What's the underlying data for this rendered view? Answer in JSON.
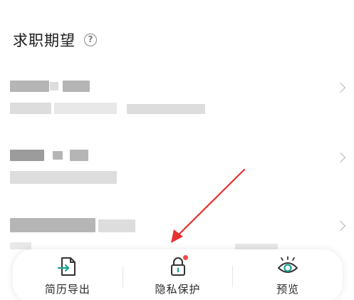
{
  "section": {
    "title": "求职期望",
    "help_icon": "question-circle-icon"
  },
  "rows": [
    {
      "chevron_icon": "chevron-right-icon"
    },
    {
      "chevron_icon": "chevron-right-icon"
    },
    {
      "chevron_icon": "chevron-right-icon"
    }
  ],
  "bottom_bar": {
    "items": [
      {
        "label": "简历导出",
        "icon": "resume-export-icon"
      },
      {
        "label": "隐私保护",
        "icon": "lock-icon",
        "badge": "red-dot",
        "badge_color": "#f04848"
      },
      {
        "label": "预览",
        "icon": "eye-icon"
      }
    ]
  },
  "annotation": {
    "arrow_color": "#e8322f",
    "points_to": "隐私保护"
  },
  "colors": {
    "accent": "#1aa392",
    "badge": "#f04848"
  }
}
